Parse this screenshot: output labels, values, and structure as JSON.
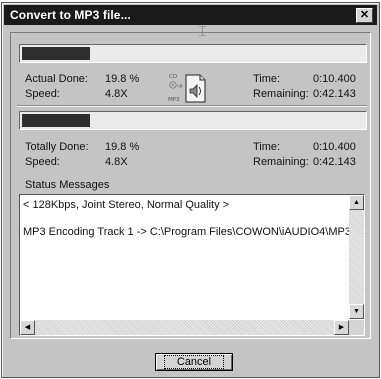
{
  "window": {
    "title": "Convert to MP3 file...",
    "close_glyph": "✕"
  },
  "title_cursor_icon": "text-cursor-icon",
  "track": {
    "progress": 0.198,
    "actual_done_label": "Actual Done:",
    "actual_done_value": "19.8 %",
    "speed_label": "Speed:",
    "speed_value": "4.8X",
    "time_label": "Time:",
    "time_value": "0:10.400",
    "remaining_label": "Remaining:",
    "remaining_value": "0:42.143"
  },
  "conversion_icon": {
    "name": "cd-to-mp3-icon",
    "cd_text": "CD",
    "mp3_text": "MP3"
  },
  "total": {
    "progress": 0.198,
    "totally_done_label": "Totally Done:",
    "totally_done_value": "19.8 %",
    "speed_label": "Speed:",
    "speed_value": "4.8X",
    "time_label": "Time:",
    "time_value": "0:10.400",
    "remaining_label": "Remaining:",
    "remaining_value": "0:42.143"
  },
  "status": {
    "heading": "Status Messages",
    "messages": [
      "< 128Kbps, Joint Stereo, Normal Quality >",
      "MP3 Encoding Track  1 -> C:\\Program Files\\COWON\\iAUDIO4\\MP3"
    ]
  },
  "buttons": {
    "cancel": "Cancel"
  },
  "colors": {
    "titlebar": "#1a1a1a",
    "dialog": "#c4c4c4",
    "progress_fill": "#2e2e2e"
  }
}
